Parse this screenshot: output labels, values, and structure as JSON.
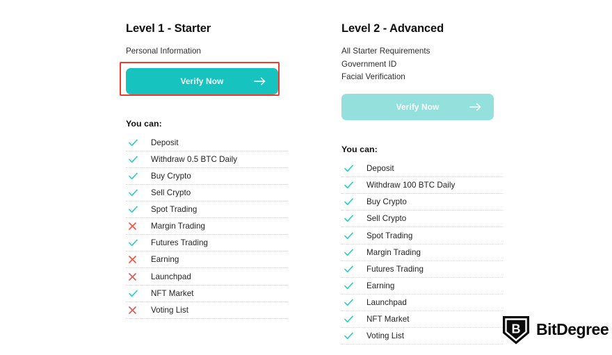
{
  "levels": [
    {
      "title": "Level 1 - Starter",
      "requirements": [
        "Personal Information"
      ],
      "button": {
        "label": "Verify Now",
        "icon": "arrow-right-icon",
        "state": "active",
        "color": "#17c3be",
        "highlighted": true,
        "highlight_color": "#ef3b2b"
      },
      "you_can_label": "You can:",
      "features": [
        {
          "label": "Deposit",
          "status": "yes"
        },
        {
          "label": "Withdraw 0.5 BTC Daily",
          "status": "yes"
        },
        {
          "label": "Buy Crypto",
          "status": "yes"
        },
        {
          "label": "Sell Crypto",
          "status": "yes"
        },
        {
          "label": "Spot Trading",
          "status": "yes"
        },
        {
          "label": "Margin Trading",
          "status": "no"
        },
        {
          "label": "Futures Trading",
          "status": "yes"
        },
        {
          "label": "Earning",
          "status": "no"
        },
        {
          "label": "Launchpad",
          "status": "no"
        },
        {
          "label": "NFT Market",
          "status": "yes"
        },
        {
          "label": "Voting List",
          "status": "no"
        }
      ]
    },
    {
      "title": "Level 2 - Advanced",
      "requirements": [
        "All Starter Requirements",
        "Government ID",
        "Facial Verification"
      ],
      "button": {
        "label": "Verify Now",
        "icon": "arrow-right-icon",
        "state": "disabled",
        "color": "#94e0dc",
        "highlighted": false,
        "highlight_color": ""
      },
      "you_can_label": "You can:",
      "features": [
        {
          "label": "Deposit",
          "status": "yes"
        },
        {
          "label": "Withdraw 100 BTC Daily",
          "status": "yes"
        },
        {
          "label": "Buy Crypto",
          "status": "yes"
        },
        {
          "label": "Sell Crypto",
          "status": "yes"
        },
        {
          "label": "Spot Trading",
          "status": "yes"
        },
        {
          "label": "Margin Trading",
          "status": "yes"
        },
        {
          "label": "Futures Trading",
          "status": "yes"
        },
        {
          "label": "Earning",
          "status": "yes"
        },
        {
          "label": "Launchpad",
          "status": "yes"
        },
        {
          "label": "NFT Market",
          "status": "yes"
        },
        {
          "label": "Voting List",
          "status": "yes"
        }
      ]
    }
  ],
  "watermark": {
    "brand": "BitDegree",
    "mark_letter": "B",
    "color": "#0c0c0c"
  },
  "colors": {
    "check": "#2ecfc6",
    "cross": "#f1574a",
    "text": "#222222",
    "heading": "#101010",
    "row_divider": "#d8d8d8"
  }
}
